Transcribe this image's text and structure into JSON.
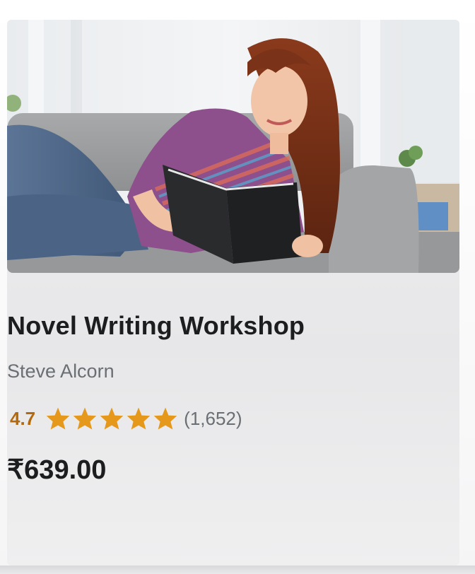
{
  "course": {
    "title": "Novel Writing Workshop",
    "instructor": "Steve Alcorn",
    "rating": "4.7",
    "stars": 5,
    "rating_count": "(1,652)",
    "price": "₹639.00"
  },
  "colors": {
    "rating": "#b4690e",
    "star": "#e59819",
    "title": "#1c1d1f",
    "muted": "#6a6f73"
  },
  "icons": {
    "star": "star-icon"
  }
}
